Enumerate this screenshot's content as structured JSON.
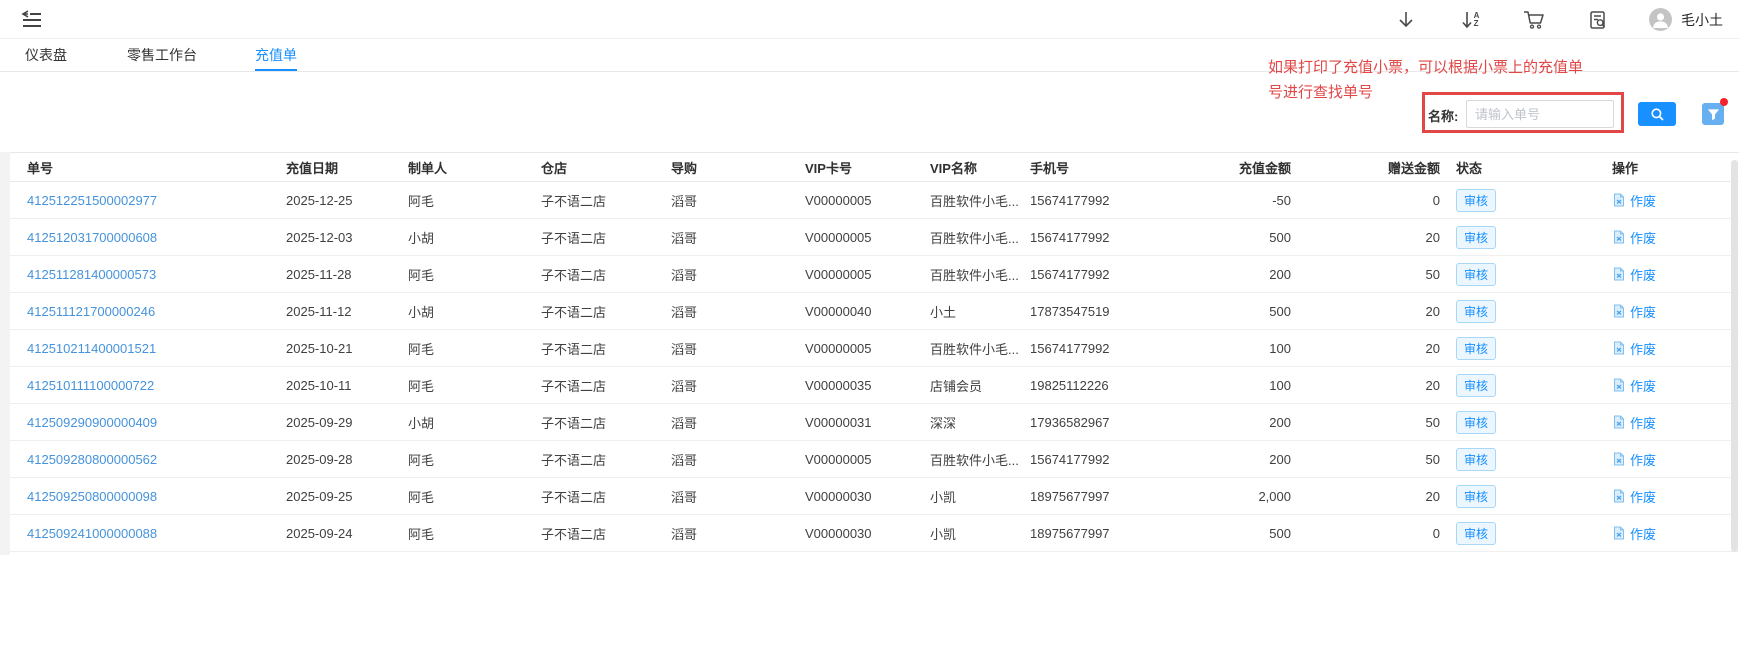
{
  "topbar": {
    "username": "毛小土",
    "icons": [
      "menu-fold-icon",
      "download-icon",
      "sort-az-icon",
      "cart-icon",
      "doc-search-icon",
      "avatar"
    ]
  },
  "tabs": [
    {
      "label": "仪表盘",
      "active": false
    },
    {
      "label": "零售工作台",
      "active": false
    },
    {
      "label": "充值单",
      "active": true
    }
  ],
  "annotation": {
    "line1": "如果打印了充值小票，可以根据小票上的充值单",
    "line2": "号进行查找单号"
  },
  "search": {
    "label": "名称:",
    "placeholder": "请输入单号"
  },
  "table": {
    "headers": [
      "单号",
      "充值日期",
      "制单人",
      "仓店",
      "导购",
      "VIP卡号",
      "VIP名称",
      "手机号",
      "充值金额",
      "赠送金额",
      "状态",
      "操作"
    ],
    "status_label": "审核",
    "action_label": "作废",
    "rows": [
      [
        "412512251500002977",
        "2025-12-25",
        "阿毛",
        "子不语二店",
        "滔哥",
        "V00000005",
        "百胜软件小毛...",
        "15674177992",
        "-50",
        "0"
      ],
      [
        "412512031700000608",
        "2025-12-03",
        "小胡",
        "子不语二店",
        "滔哥",
        "V00000005",
        "百胜软件小毛...",
        "15674177992",
        "500",
        "20"
      ],
      [
        "412511281400000573",
        "2025-11-28",
        "阿毛",
        "子不语二店",
        "滔哥",
        "V00000005",
        "百胜软件小毛...",
        "15674177992",
        "200",
        "50"
      ],
      [
        "412511121700000246",
        "2025-11-12",
        "小胡",
        "子不语二店",
        "滔哥",
        "V00000040",
        "小土",
        "17873547519",
        "500",
        "20"
      ],
      [
        "412510211400001521",
        "2025-10-21",
        "阿毛",
        "子不语二店",
        "滔哥",
        "V00000005",
        "百胜软件小毛...",
        "15674177992",
        "100",
        "20"
      ],
      [
        "412510111100000722",
        "2025-10-11",
        "阿毛",
        "子不语二店",
        "滔哥",
        "V00000035",
        "店铺会员",
        "19825112226",
        "100",
        "20"
      ],
      [
        "412509290900000409",
        "2025-09-29",
        "小胡",
        "子不语二店",
        "滔哥",
        "V00000031",
        "深深",
        "17936582967",
        "200",
        "50"
      ],
      [
        "412509280800000562",
        "2025-09-28",
        "阿毛",
        "子不语二店",
        "滔哥",
        "V00000005",
        "百胜软件小毛...",
        "15674177992",
        "200",
        "50"
      ],
      [
        "412509250800000098",
        "2025-09-25",
        "阿毛",
        "子不语二店",
        "滔哥",
        "V00000030",
        "小凯",
        "18975677997",
        "2,000",
        "20"
      ],
      [
        "412509241000000088",
        "2025-09-24",
        "阿毛",
        "子不语二店",
        "滔哥",
        "V00000030",
        "小凯",
        "18975677997",
        "500",
        "0"
      ]
    ]
  },
  "colors": {
    "accent": "#1890ff",
    "link": "#4593dc",
    "annotation_red": "#e14747",
    "badge_bg": "#ecf6ff",
    "badge_border": "#a8d8f8"
  }
}
